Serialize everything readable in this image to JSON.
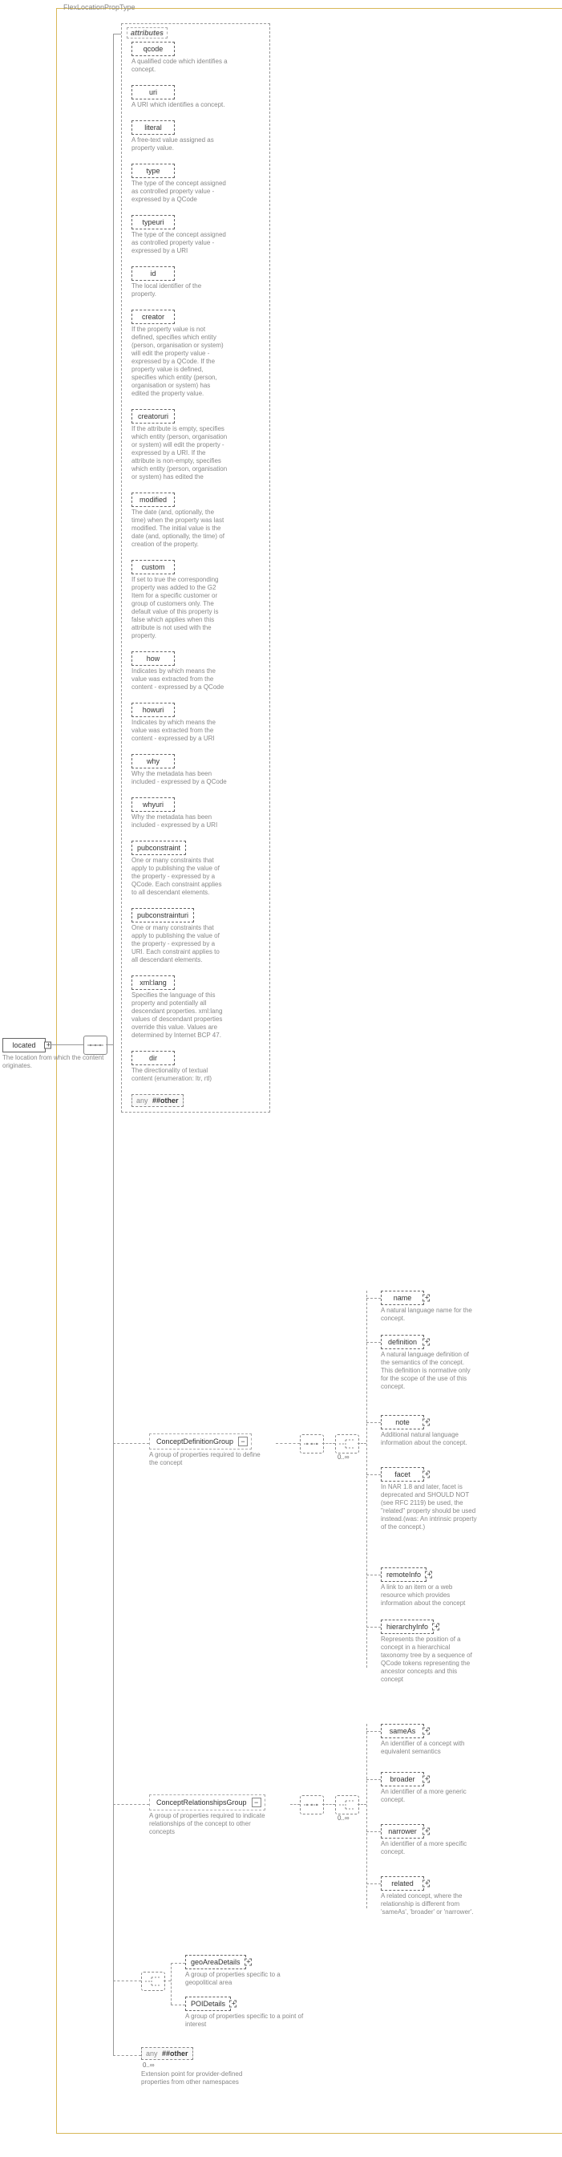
{
  "typeName": "FlexLocationPropType",
  "root": {
    "label": "located",
    "desc": "The location from which the content originates."
  },
  "attributesHeader": "attributes",
  "anyOther": {
    "any": "any",
    "qual": "##other"
  },
  "occurs": {
    "zeroInf": "0..∞"
  },
  "attrs": [
    {
      "name": "qcode",
      "desc": "A qualified code which identifies a concept."
    },
    {
      "name": "uri",
      "desc": "A URI which identifies a concept."
    },
    {
      "name": "literal",
      "desc": "A free-text value assigned as property value."
    },
    {
      "name": "type",
      "desc": "The type of the concept assigned as controlled property value - expressed by a QCode"
    },
    {
      "name": "typeuri",
      "desc": "The type of the concept assigned as controlled property value - expressed by a URI"
    },
    {
      "name": "id",
      "desc": "The local identifier of the property."
    },
    {
      "name": "creator",
      "desc": "If the property value is not defined, specifies which entity (person, organisation or system) will edit the property value - expressed by a QCode. If the property value is defined, specifies which entity (person, organisation or system) has edited the property value."
    },
    {
      "name": "creatoruri",
      "desc": "If the attribute is empty, specifies which entity (person, organisation or system) will edit the property - expressed by a URI. If the attribute is non-empty, specifies which entity (person, organisation or system) has edited the"
    },
    {
      "name": "modified",
      "desc": "The date (and, optionally, the time) when the property was last modified. The initial value is the date (and, optionally, the time) of creation of the property."
    },
    {
      "name": "custom",
      "desc": "If set to true the corresponding property was added to the G2 Item for a specific customer or group of customers only. The default value of this property is false which applies when this attribute is not used with the property."
    },
    {
      "name": "how",
      "desc": "Indicates by which means the value was extracted from the content - expressed by a QCode"
    },
    {
      "name": "howuri",
      "desc": "Indicates by which means the value was extracted from the content - expressed by a URI"
    },
    {
      "name": "why",
      "desc": "Why the metadata has been included - expressed by a QCode"
    },
    {
      "name": "whyuri",
      "desc": "Why the metadata has been included - expressed by a URI"
    },
    {
      "name": "pubconstraint",
      "desc": "One or many constraints that apply to publishing the value of the property - expressed by a QCode. Each constraint applies to all descendant elements."
    },
    {
      "name": "pubconstrainturi",
      "desc": "One or many constraints that apply to publishing the value of the property - expressed by a URI. Each constraint applies to all descendant elements."
    },
    {
      "name": "xml:lang",
      "desc": "Specifies the language of this property and potentially all descendant properties. xml:lang values of descendant properties override this value. Values are determined by Internet BCP 47."
    },
    {
      "name": "dir",
      "desc": "The directionality of textual content (enumeration: ltr, rtl)"
    }
  ],
  "groups": {
    "cdg": {
      "label": "ConceptDefinitionGroup",
      "desc": "A group of properties required to define the concept"
    },
    "crg": {
      "label": "ConceptRelationshipsGroup",
      "desc": "A group of properties required to indicate relationships of the concept to other concepts"
    },
    "geo": {
      "label": "geoAreaDetails",
      "desc": "A group of properties specific to a geopolitical area"
    },
    "poi": {
      "label": "POIDetails",
      "desc": "A group of properties specific to a point of interest"
    },
    "extAny": {
      "desc": "Extension point for provider-defined properties from other namespaces"
    }
  },
  "cdgChildren": [
    {
      "name": "name",
      "desc": "A natural language name for the concept."
    },
    {
      "name": "definition",
      "desc": "A natural language definition of the semantics of the concept. This definition is normative only for the scope of the use of this concept."
    },
    {
      "name": "note",
      "desc": "Additional natural language information about the concept."
    },
    {
      "name": "facet",
      "desc": "In NAR 1.8 and later, facet is deprecated and SHOULD NOT (see RFC 2119) be used, the \"related\" property should be used instead.(was: An intrinsic property of the concept.)"
    },
    {
      "name": "remoteInfo",
      "desc": "A link to an item or a web resource which provides information about the concept"
    },
    {
      "name": "hierarchyInfo",
      "desc": "Represents the position of a concept in a hierarchical taxonomy tree by a sequence of QCode tokens representing the ancestor concepts and this concept"
    }
  ],
  "crgChildren": [
    {
      "name": "sameAs",
      "desc": "An identifier of a concept with equivalent semantics"
    },
    {
      "name": "broader",
      "desc": "An identifier of a more generic concept."
    },
    {
      "name": "narrower",
      "desc": "An identifier of a more specific concept."
    },
    {
      "name": "related",
      "desc": "A related concept, where the relationship is different from 'sameAs', 'broader' or 'narrower'."
    }
  ]
}
